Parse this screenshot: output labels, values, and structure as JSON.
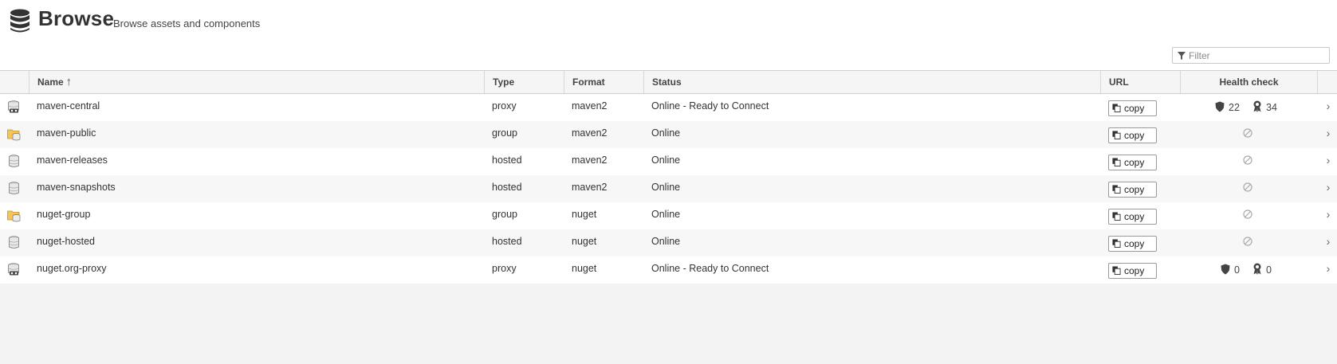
{
  "header": {
    "title": "Browse",
    "subtitle": "Browse assets and components",
    "icon": "database-icon"
  },
  "filter": {
    "placeholder": "Filter",
    "value": ""
  },
  "columns": {
    "name": "Name",
    "type": "Type",
    "format": "Format",
    "status": "Status",
    "url": "URL",
    "health": "Health check",
    "sort_indicator": "🠕"
  },
  "copy_label": "copy",
  "rows": [
    {
      "icon": "proxy-repository-icon",
      "name": "maven-central",
      "type": "proxy",
      "format": "maven2",
      "status": "Online - Ready to Connect",
      "health": {
        "available": true,
        "vulnerabilities": "22",
        "license_issues": "34"
      }
    },
    {
      "icon": "group-repository-icon",
      "name": "maven-public",
      "type": "group",
      "format": "maven2",
      "status": "Online",
      "health": {
        "available": false
      }
    },
    {
      "icon": "hosted-repository-icon",
      "name": "maven-releases",
      "type": "hosted",
      "format": "maven2",
      "status": "Online",
      "health": {
        "available": false
      }
    },
    {
      "icon": "hosted-repository-icon",
      "name": "maven-snapshots",
      "type": "hosted",
      "format": "maven2",
      "status": "Online",
      "health": {
        "available": false
      }
    },
    {
      "icon": "group-repository-icon",
      "name": "nuget-group",
      "type": "group",
      "format": "nuget",
      "status": "Online",
      "health": {
        "available": false
      }
    },
    {
      "icon": "hosted-repository-icon",
      "name": "nuget-hosted",
      "type": "hosted",
      "format": "nuget",
      "status": "Online",
      "health": {
        "available": false
      }
    },
    {
      "icon": "proxy-repository-icon",
      "name": "nuget.org-proxy",
      "type": "proxy",
      "format": "nuget",
      "status": "Online - Ready to Connect",
      "health": {
        "available": true,
        "vulnerabilities": "0",
        "license_issues": "0"
      }
    }
  ]
}
